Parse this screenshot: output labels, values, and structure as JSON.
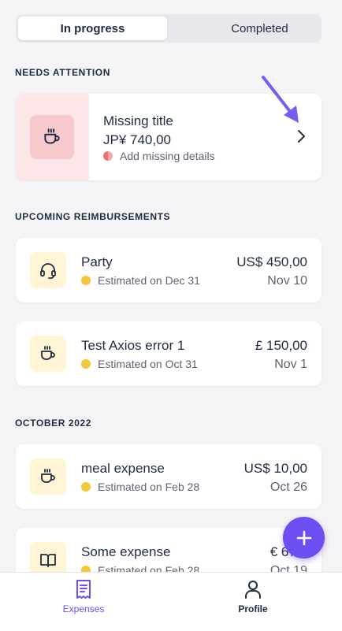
{
  "segments": {
    "in_progress": "In progress",
    "completed": "Completed"
  },
  "needs_attention": {
    "header": "NEEDS ATTENTION",
    "card": {
      "title": "Missing title",
      "amount": "JP¥ 740,00",
      "status": "Add missing details",
      "icon": "coffee-cup-icon"
    }
  },
  "upcoming": {
    "header": "UPCOMING REIMBURSEMENTS",
    "items": [
      {
        "title": "Party",
        "status": "Estimated on Dec 31",
        "amount": "US$ 450,00",
        "date": "Nov 10",
        "icon": "headset-icon"
      },
      {
        "title": "Test Axios error 1",
        "status": "Estimated on Oct 31",
        "amount": "£ 150,00",
        "date": "Nov 1",
        "icon": "coffee-cup-icon"
      }
    ]
  },
  "october": {
    "header": "OCTOBER 2022",
    "items": [
      {
        "title": "meal expense",
        "status": "Estimated on Feb 28",
        "amount": "US$ 10,00",
        "date": "Oct 26",
        "icon": "coffee-cup-icon"
      },
      {
        "title": "Some expense",
        "status": "Estimated on Feb 28",
        "amount": "€ 678,",
        "date": "Oct 19",
        "icon": "book-icon"
      }
    ]
  },
  "tabs": {
    "expenses": "Expenses",
    "profile": "Profile"
  },
  "colors": {
    "accent": "#6e4ef0",
    "attention_bg": "#fde6e7",
    "icon_bg": "#fff4d4",
    "status_yellow": "#f5c53a",
    "status_red": "#f06f74"
  }
}
